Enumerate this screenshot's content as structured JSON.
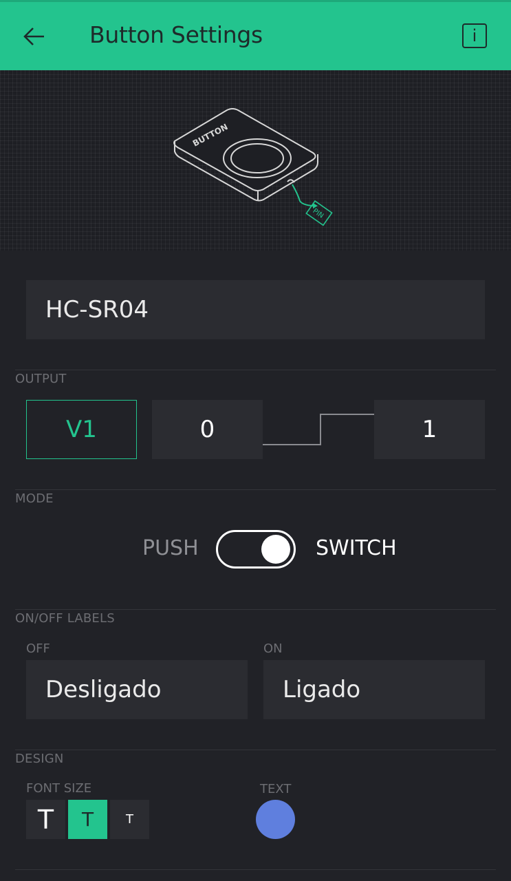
{
  "header": {
    "title": "Button Settings",
    "back_icon": "arrow-left-icon",
    "info_icon": "info-icon",
    "bg_color": "#23c48e"
  },
  "illustration": {
    "button_text": "BUTTON",
    "pin_text": "PIN"
  },
  "name_field": {
    "value": "HC-SR04"
  },
  "output": {
    "label": "OUTPUT",
    "pin": "V1",
    "low_value": "0",
    "high_value": "1"
  },
  "mode": {
    "label": "MODE",
    "push": "PUSH",
    "switch": "SWITCH",
    "selected": "SWITCH"
  },
  "labels": {
    "label": "ON/OFF LABELS",
    "off_label": "OFF",
    "off_value": "Desligado",
    "on_label": "ON",
    "on_value": "Ligado"
  },
  "design": {
    "label": "DESIGN",
    "font_size_label": "FONT SIZE",
    "font_sizes": [
      "T",
      "T",
      "T"
    ],
    "selected_font_index": 1,
    "text_label": "TEXT",
    "text_color": "#5f7fde"
  }
}
